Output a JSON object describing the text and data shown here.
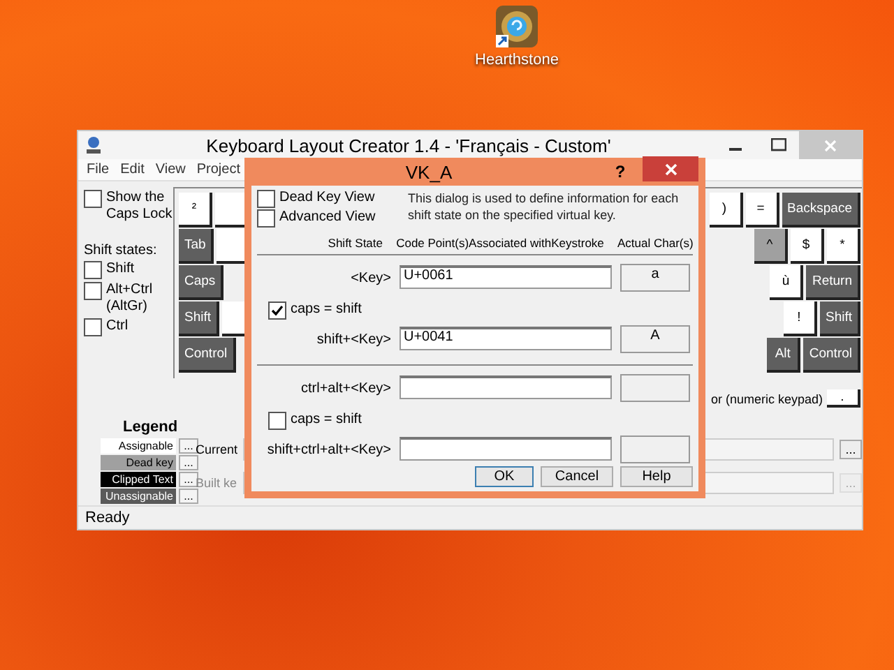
{
  "desktop_icon": {
    "label": "Hearthstone"
  },
  "window": {
    "title": "Keyboard Layout Creator 1.4 - 'Français - Custom'",
    "menu": [
      "File",
      "Edit",
      "View",
      "Project"
    ],
    "left_panel": {
      "caps_lock": {
        "label": "Show the Caps Lock",
        "checked": false
      },
      "shift_states_label": "Shift states:",
      "shift_states": [
        {
          "label": "Shift",
          "checked": false
        },
        {
          "label": "Alt+Ctrl (AltGr)",
          "checked": false
        },
        {
          "label": "Ctrl",
          "checked": false
        }
      ]
    },
    "keyboard": {
      "rows": [
        {
          "left": [
            {
              "label": "²",
              "kind": "assignable"
            },
            {
              "kind": "assignable"
            }
          ],
          "right": [
            {
              "label": ")",
              "kind": "assignable"
            },
            {
              "label": "=",
              "kind": "assignable"
            },
            {
              "label": "Backspace",
              "kind": "unassignable"
            }
          ]
        },
        {
          "left": [
            {
              "label": "Tab",
              "kind": "unassignable"
            },
            {
              "kind": "assignable"
            }
          ],
          "right": [
            {
              "label": "^",
              "kind": "dead"
            },
            {
              "label": "$",
              "kind": "assignable"
            },
            {
              "label": "*",
              "kind": "assignable"
            }
          ]
        },
        {
          "left": [
            {
              "label": "Caps",
              "kind": "unassignable"
            }
          ],
          "right": [
            {
              "label": "ù",
              "kind": "assignable"
            },
            {
              "label": "Return",
              "kind": "unassignable"
            }
          ]
        },
        {
          "left": [
            {
              "label": "Shift",
              "kind": "unassignable"
            },
            {
              "kind": "assignable"
            }
          ],
          "right": [
            {
              "label": "!",
              "kind": "assignable"
            },
            {
              "label": "Shift",
              "kind": "unassignable"
            }
          ]
        },
        {
          "left": [
            {
              "label": "Control",
              "kind": "unassignable"
            }
          ],
          "right": [
            {
              "label": "Alt",
              "kind": "unassignable"
            },
            {
              "label": "Control",
              "kind": "unassignable"
            }
          ]
        }
      ],
      "keypad_note": "or (numeric keypad)",
      "keypad_key": {
        "label": ".",
        "kind": "assignable"
      }
    },
    "legend": {
      "title": "Legend",
      "items": [
        {
          "label": "Assignable",
          "color": "#ffffff",
          "button": "..."
        },
        {
          "label": "Dead key",
          "color": "#a0a0a0",
          "button": "..."
        },
        {
          "label": "Clipped Text",
          "color": "#000000",
          "button": "..."
        },
        {
          "label": "Unassignable",
          "color": "#5a5a5a",
          "button": "..."
        }
      ]
    },
    "fields": [
      {
        "label": "Current",
        "button": "...",
        "disabled": false
      },
      {
        "label": "Built ke",
        "button": "...",
        "disabled": true
      }
    ],
    "status_bar": "Ready"
  },
  "dialog": {
    "title": "VK_A",
    "help_button": "?",
    "view_options": [
      {
        "label": "Dead Key View",
        "checked": false
      },
      {
        "label": "Advanced View",
        "checked": false
      }
    ],
    "description": "This dialog is used to define information for each shift state on the specified virtual key.",
    "columns": [
      "Shift State",
      "Code Point(s)Associated withKeystroke",
      "Actual Char(s)"
    ],
    "rows": [
      {
        "kind": "entry",
        "label": "<Key>",
        "value": "U+0061",
        "char": "a"
      },
      {
        "kind": "checkbox",
        "label": "caps = shift",
        "checked": true
      },
      {
        "kind": "entry",
        "label": "shift+<Key>",
        "value": "U+0041",
        "char": "A"
      },
      {
        "kind": "divider"
      },
      {
        "kind": "entry",
        "label": "ctrl+alt+<Key>",
        "value": "",
        "char": ""
      },
      {
        "kind": "checkbox",
        "label": "caps = shift",
        "checked": false
      },
      {
        "kind": "entry",
        "label": "shift+ctrl+alt+<Key>",
        "value": "",
        "char": ""
      }
    ],
    "buttons": [
      {
        "label": "OK",
        "default": true
      },
      {
        "label": "Cancel",
        "default": false
      },
      {
        "label": "Help",
        "default": false
      }
    ]
  }
}
